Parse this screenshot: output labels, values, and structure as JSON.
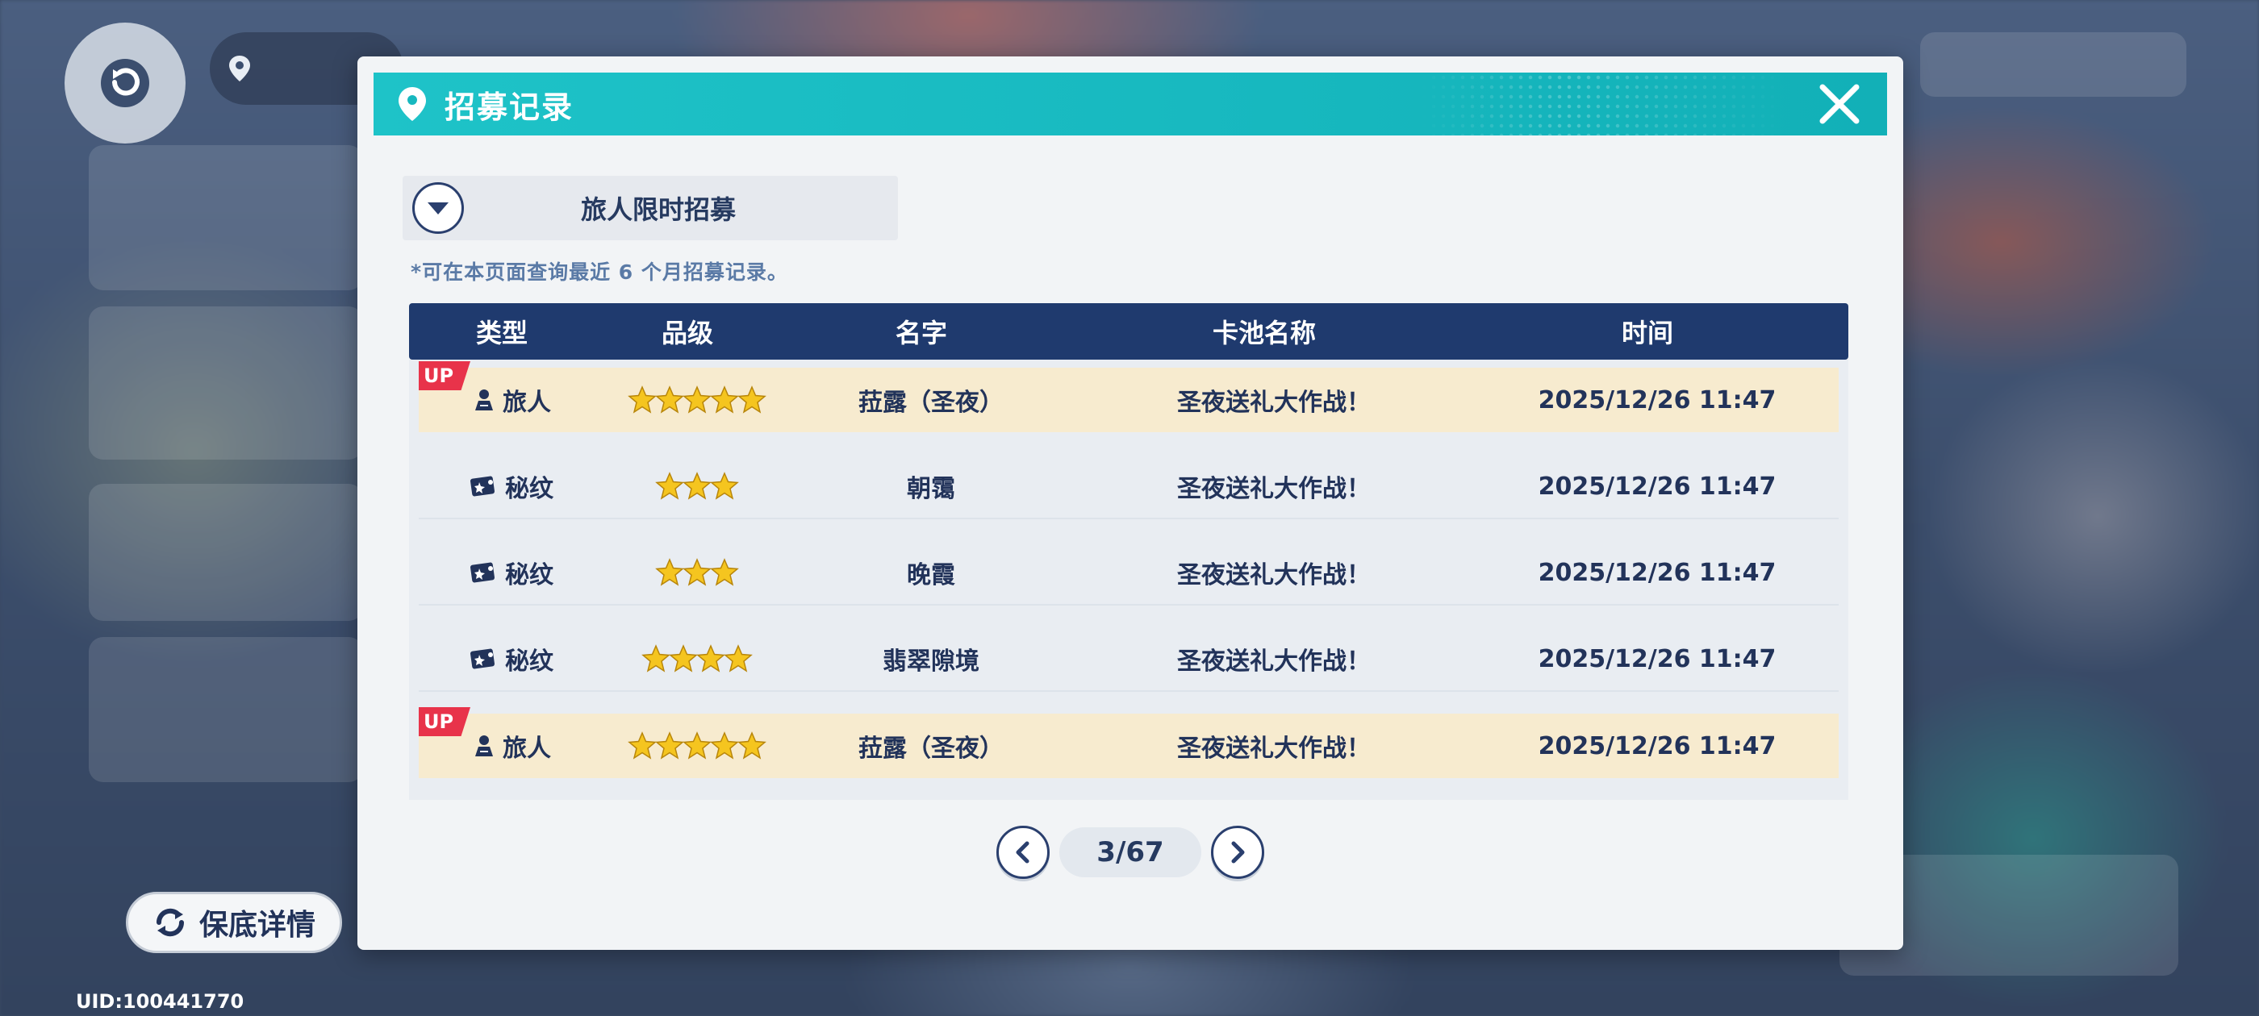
{
  "modal": {
    "title": "招募记录",
    "pool_selected": "旅人限时招募",
    "notice": "*可在本页面查询最近 6 个月招募记录。"
  },
  "table": {
    "headers": {
      "type": "类型",
      "rank": "品级",
      "name": "名字",
      "pool": "卡池名称",
      "time": "时间"
    },
    "rows": [
      {
        "up": "UP",
        "type": "旅人",
        "type_icon": "traveler-icon",
        "stars": 5,
        "name": "菈露（圣夜）",
        "pool": "圣夜送礼大作战！",
        "time": "2025/12/26 11:47"
      },
      {
        "up": "",
        "type": "秘纹",
        "type_icon": "rune-icon",
        "stars": 3,
        "name": "朝霭",
        "pool": "圣夜送礼大作战！",
        "time": "2025/12/26 11:47"
      },
      {
        "up": "",
        "type": "秘纹",
        "type_icon": "rune-icon",
        "stars": 3,
        "name": "晚霞",
        "pool": "圣夜送礼大作战！",
        "time": "2025/12/26 11:47"
      },
      {
        "up": "",
        "type": "秘纹",
        "type_icon": "rune-icon",
        "stars": 4,
        "name": "翡翠隙境",
        "pool": "圣夜送礼大作战！",
        "time": "2025/12/26 11:47"
      },
      {
        "up": "UP",
        "type": "旅人",
        "type_icon": "traveler-icon",
        "stars": 5,
        "name": "菈露（圣夜）",
        "pool": "圣夜送礼大作战！",
        "time": "2025/12/26 11:47"
      }
    ]
  },
  "pager": {
    "label": "3/67"
  },
  "pity_button": "保底详情",
  "uid": "UID:100441770",
  "colors": {
    "header_teal": "#17b8bf",
    "table_header_navy": "#1f3a6e",
    "up_row": "#f7ebcf",
    "up_badge": "#e8334a",
    "star_gold": "#f5c51f"
  }
}
